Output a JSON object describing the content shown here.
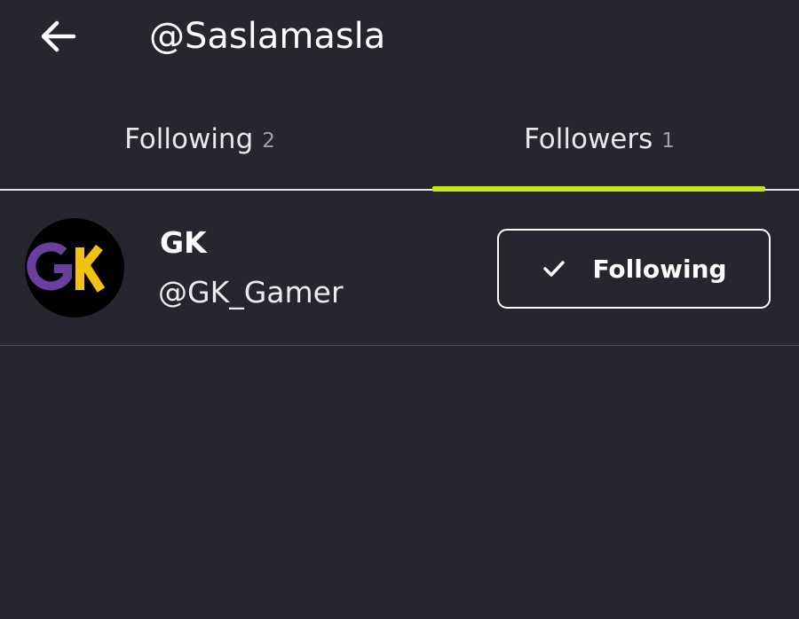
{
  "header": {
    "title": "@Saslamasla",
    "back_icon": "arrow-left-icon"
  },
  "tabs": [
    {
      "label": "Following",
      "count": "2",
      "active": false
    },
    {
      "label": "Followers",
      "count": "1",
      "active": true
    }
  ],
  "colors": {
    "background": "#27252d",
    "accent": "#c4e61c",
    "avatar_g": "#6b3fa0",
    "avatar_k": "#f2c111"
  },
  "followers": [
    {
      "name": "GK",
      "handle": "@GK_Gamer",
      "avatar_text": "GK",
      "button_label": "Following",
      "button_icon": "check-icon"
    }
  ]
}
